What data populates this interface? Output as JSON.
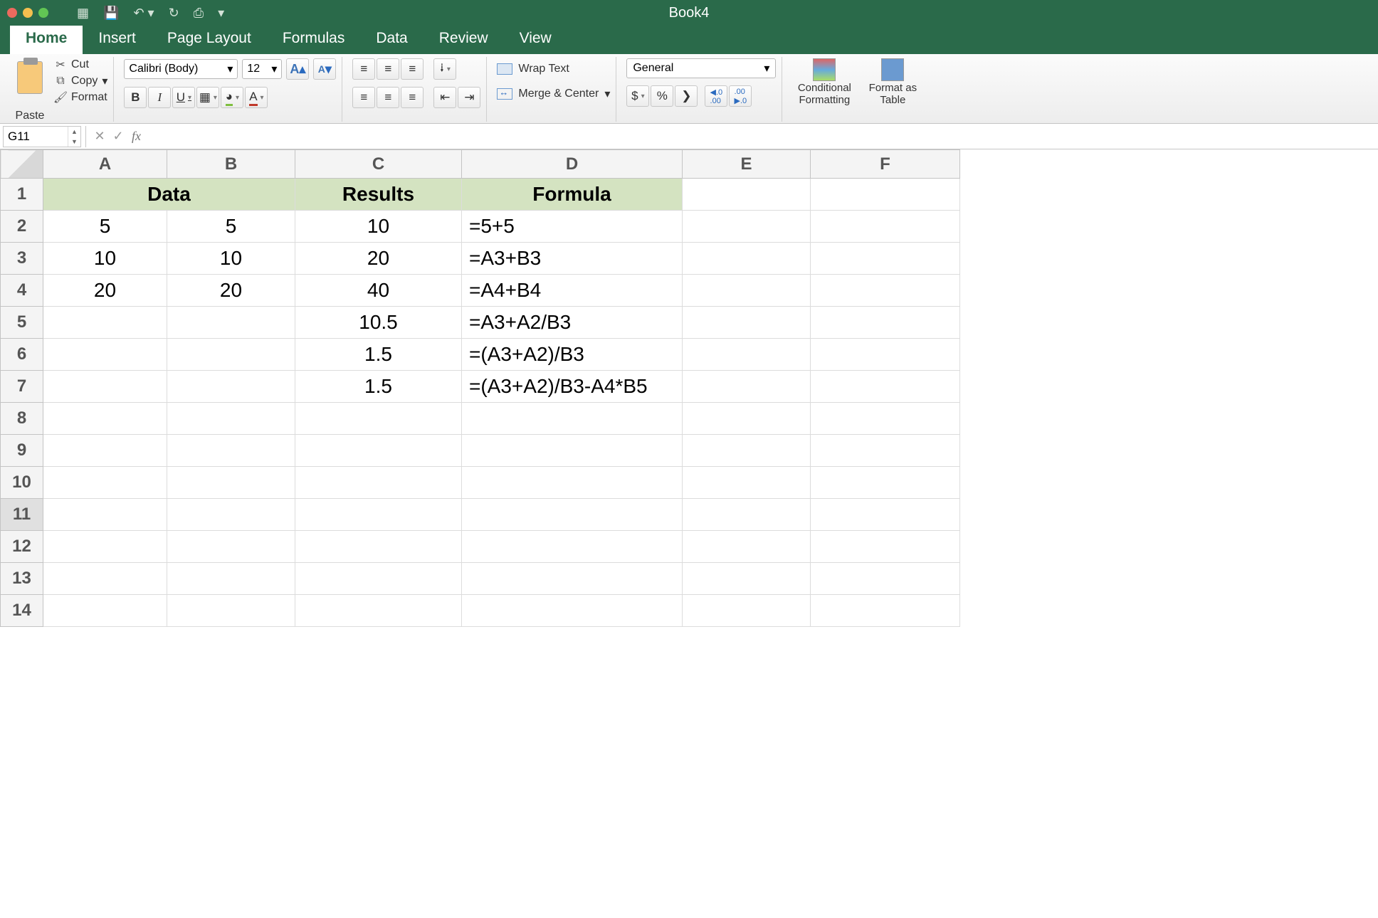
{
  "title": "Book4",
  "tabs": [
    "Home",
    "Insert",
    "Page Layout",
    "Formulas",
    "Data",
    "Review",
    "View"
  ],
  "active_tab": "Home",
  "clipboard": {
    "paste": "Paste",
    "cut": "Cut",
    "copy": "Copy",
    "format": "Format"
  },
  "font": {
    "name": "Calibri (Body)",
    "size": "12",
    "bold": "B",
    "italic": "I",
    "underline": "U"
  },
  "alignment": {
    "wrap": "Wrap Text",
    "merge": "Merge & Center"
  },
  "number": {
    "format": "General",
    "currency": "$",
    "percent": "%",
    "comma": "❯",
    "inc": ".0",
    "dec": ".00"
  },
  "styles": {
    "conditional": "Conditional Formatting",
    "table": "Format as Table"
  },
  "formula_bar": {
    "namebox": "G11",
    "value": ""
  },
  "columns": [
    "A",
    "B",
    "C",
    "D",
    "E",
    "F"
  ],
  "row_count": 14,
  "selected_row": 11,
  "chart_data": {
    "type": "table",
    "header_row": 1,
    "headers": {
      "A": "Data",
      "B": "",
      "C": "Results",
      "D": "Formula"
    },
    "merged": [
      [
        "A1",
        "B1"
      ]
    ],
    "rows": [
      {
        "r": 2,
        "A": "5",
        "B": "5",
        "C": "10",
        "D": "=5+5"
      },
      {
        "r": 3,
        "A": "10",
        "B": "10",
        "C": "20",
        "D": "=A3+B3"
      },
      {
        "r": 4,
        "A": "20",
        "B": "20",
        "C": "40",
        "D": "=A4+B4"
      },
      {
        "r": 5,
        "A": "",
        "B": "",
        "C": "10.5",
        "D": "=A3+A2/B3"
      },
      {
        "r": 6,
        "A": "",
        "B": "",
        "C": "1.5",
        "D": "=(A3+A2)/B3"
      },
      {
        "r": 7,
        "A": "",
        "B": "",
        "C": "1.5",
        "D": "=(A3+A2)/B3-A4*B5"
      }
    ]
  }
}
